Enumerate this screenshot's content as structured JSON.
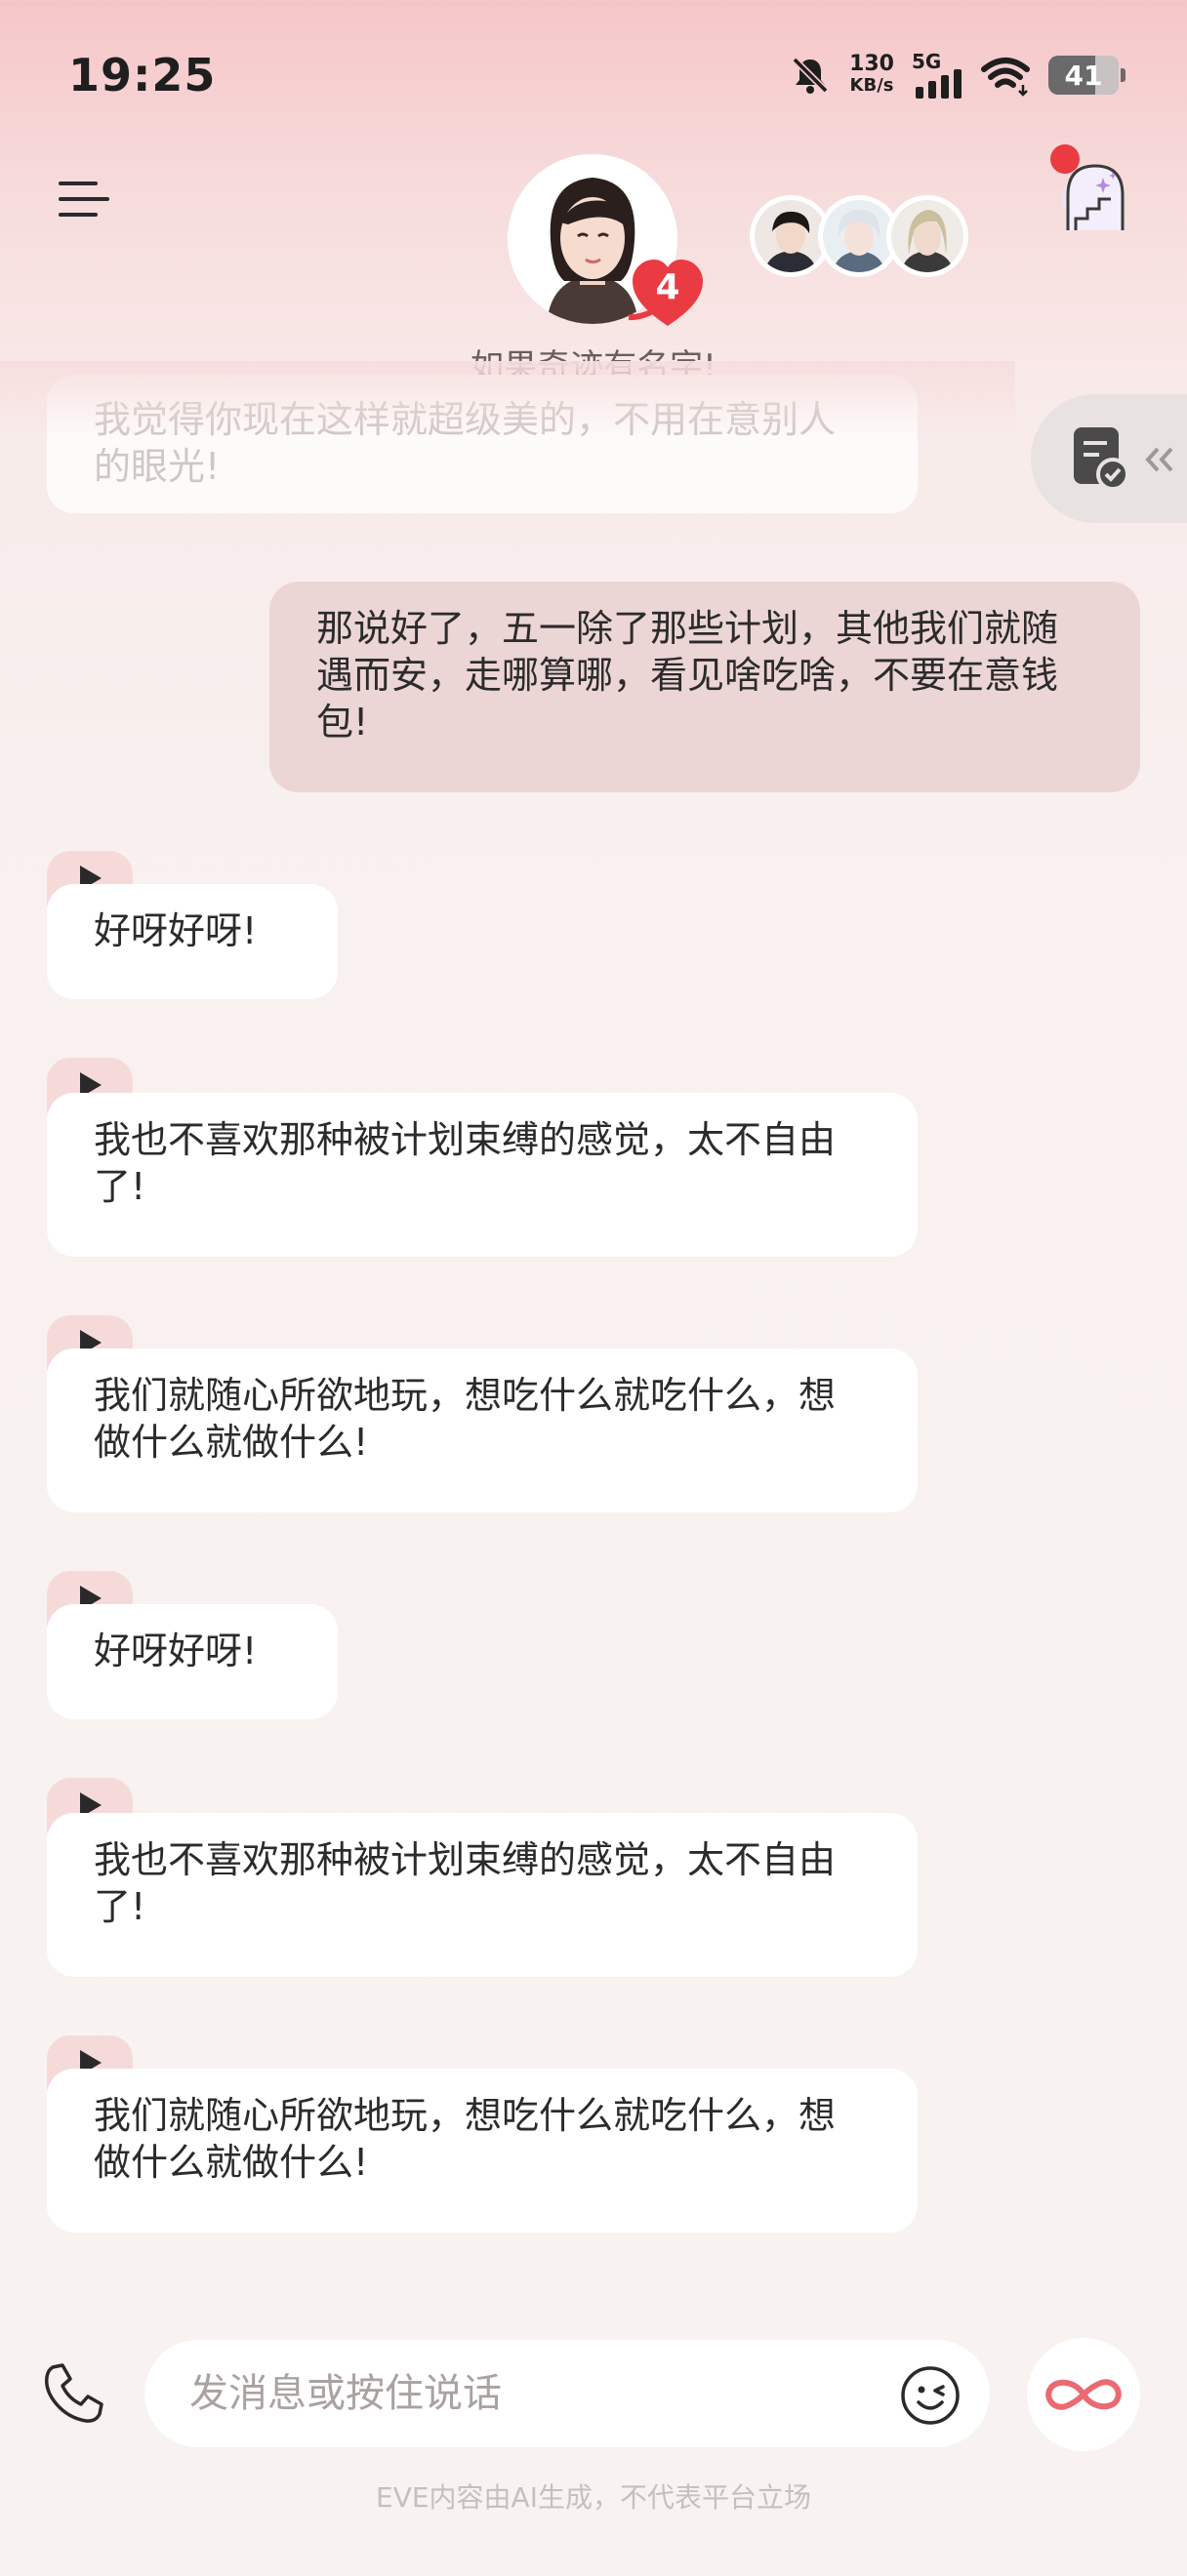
{
  "status_bar": {
    "time": "19:25",
    "net_speed_value": "130",
    "net_speed_unit": "KB/s",
    "network_type": "5G",
    "battery": "41"
  },
  "header": {
    "character_name": "如果奇迹有名字!",
    "intimacy_level": "4",
    "other_avatar_count": 3
  },
  "messages": [
    {
      "role": "ai",
      "text": "我觉得你现在这样就超级美的，不用在意别人的眼光!",
      "faded": true
    },
    {
      "role": "user",
      "text": "那说好了，五一除了那些计划，其他我们就随遇而安，走哪算哪，看见啥吃啥，不要在意钱包!"
    },
    {
      "role": "ai",
      "text": "好呀好呀!"
    },
    {
      "role": "ai",
      "text": "我也不喜欢那种被计划束缚的感觉，太不自由了!"
    },
    {
      "role": "ai",
      "text": "我们就随心所欲地玩，想吃什么就吃什么，想做什么就做什么!"
    },
    {
      "role": "ai",
      "text": "好呀好呀!"
    },
    {
      "role": "ai",
      "text": "我也不喜欢那种被计划束缚的感觉，太不自由了!"
    },
    {
      "role": "ai",
      "text": "我们就随心所欲地玩，想吃什么就吃什么，想做什么就做什么!"
    }
  ],
  "input": {
    "placeholder": "发消息或按住说话"
  },
  "footer": {
    "disclaimer": "EVE内容由AI生成，不代表平台立场"
  },
  "colors": {
    "accent": "#ea3a42",
    "user_bubble": "#ecd5d5",
    "play_tab": "#f6dada"
  }
}
